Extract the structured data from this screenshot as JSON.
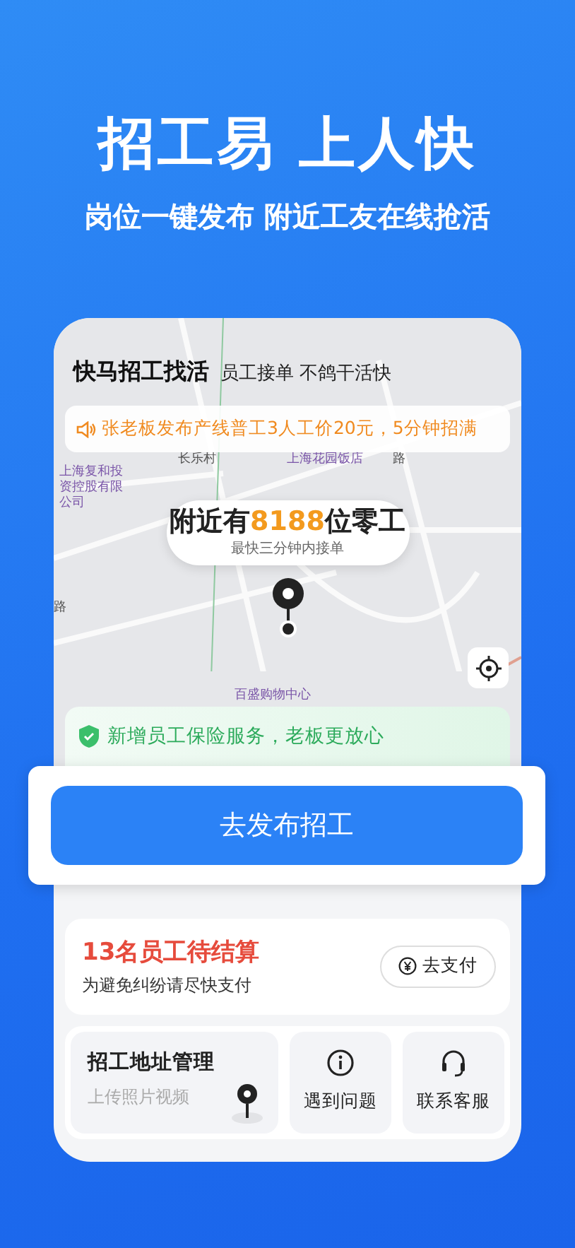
{
  "headline": "招工易 上人快",
  "subheadline": "岗位一键发布 附近工友在线抢活",
  "app": {
    "title": "快马招工找活",
    "slogan": "员工接单 不鸽干活快",
    "notice": "张老板发布产线普工3人工价20元，5分钟招满",
    "map_labels": [
      {
        "text": "上海复和投资控股有限公司",
        "kind": "poi"
      },
      {
        "text": "长乐村",
        "kind": "road"
      },
      {
        "text": "上海花园饭店",
        "kind": "poi"
      },
      {
        "text": "路",
        "kind": "road"
      },
      {
        "text": "路",
        "kind": "road"
      },
      {
        "text": "百盛购物中心",
        "kind": "poi"
      }
    ],
    "nearby": {
      "prefix": "附近有",
      "count": "8188",
      "suffix": "位零工",
      "caption": "最快三分钟内接单"
    },
    "insurance_banner": "新增员工保险服务，老板更放心",
    "publish_button": "去发布招工",
    "settlement": {
      "title": "13名员工待结算",
      "subtitle": "为避免纠纷请尽快支付",
      "pay_button": "去支付"
    },
    "address_tile": {
      "title": "招工地址管理",
      "subtitle": "上传照片视频"
    },
    "tiles": [
      {
        "label": "遇到问题",
        "kind": "help"
      },
      {
        "label": "联系客服",
        "kind": "service"
      }
    ]
  }
}
